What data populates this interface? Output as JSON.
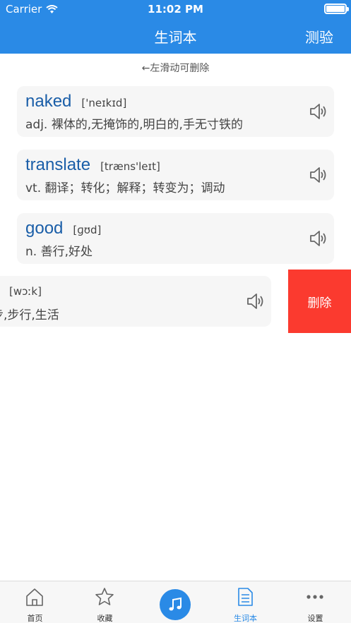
{
  "status": {
    "carrier": "Carrier",
    "time": "11:02 PM"
  },
  "nav": {
    "title": "生词本",
    "right": "测验"
  },
  "hint": "←左滑动可删除",
  "words": [
    {
      "word": "naked",
      "phonetic": "['neɪkɪd]",
      "meaning": "adj. 裸体的,无掩饰的,明白的,手无寸铁的"
    },
    {
      "word": "translate",
      "phonetic": "[træns'leɪt]",
      "meaning": "vt. 翻译；转化；解释；转变为；调动"
    },
    {
      "word": "good",
      "phonetic": "[ɡʊd]",
      "meaning": "n. 善行,好处"
    }
  ],
  "swiped": {
    "phonetic": "[wɔːk]",
    "meaning": "步,步行,生活",
    "delete": "删除"
  },
  "tabs": [
    {
      "label": "首页",
      "icon": "home-icon"
    },
    {
      "label": "收藏",
      "icon": "star-icon"
    },
    {
      "label": "",
      "icon": "music-note-icon"
    },
    {
      "label": "生词本",
      "icon": "notebook-icon"
    },
    {
      "label": "设置",
      "icon": "more-dots-icon"
    }
  ],
  "colors": {
    "primary": "#2a8ae6",
    "word": "#1a5ea8",
    "delete": "#fb3a2f"
  }
}
